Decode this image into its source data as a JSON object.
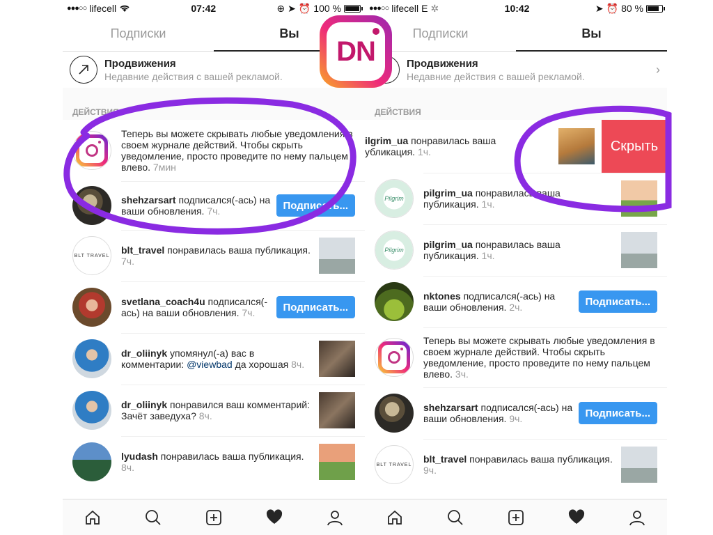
{
  "phones": [
    {
      "status": {
        "carrier": "lifecell",
        "time": "07:42",
        "battery": "100 %",
        "battery_level": 1.0
      },
      "tabs": [
        "Подписки",
        "Вы"
      ],
      "promo": {
        "title": "Продвижения",
        "subtitle": "Недавние действия с вашей рекламой."
      },
      "section": "ДЕЙСТВИЯ",
      "rows": [
        {
          "type": "notice",
          "text": "Теперь вы можете скрывать любые уведомления в своем журнале действий. Чтобы скрыть уведомление, просто проведите по нему пальцем влево.",
          "time": "7мин"
        },
        {
          "type": "follow",
          "user": "shehzarsart",
          "text": "подписался(-ась) на ваши обновления.",
          "time": "7ч.",
          "button": "Подписать..."
        },
        {
          "type": "like",
          "user": "blt_travel",
          "text": "понравилась ваша публикация.",
          "time": "7ч."
        },
        {
          "type": "follow",
          "user": "svetlana_coach4u",
          "text": "подписался(-ась) на ваши обновления.",
          "time": "7ч.",
          "button": "Подписать..."
        },
        {
          "type": "mention",
          "user": "dr_oliinyk",
          "text_before": "упомянул(-а) вас в комментарии:",
          "mention": "@viewbad",
          "text_after": "да хорошая",
          "time": "8ч."
        },
        {
          "type": "like",
          "user": "dr_oliinyk",
          "text": "понравился ваш комментарий: Зачёт заведуха?",
          "time": "8ч."
        },
        {
          "type": "like",
          "user": "lyudash",
          "text": "понравилась ваша публикация.",
          "time": "8ч."
        }
      ]
    },
    {
      "status": {
        "carrier": "lifecell",
        "network": "E",
        "time": "10:42",
        "battery": "80 %",
        "battery_level": 0.8
      },
      "tabs": [
        "Подписки",
        "Вы"
      ],
      "promo": {
        "title": "Продвижения",
        "subtitle": "Недавние действия с вашей рекламой."
      },
      "section": "ДЕЙСТВИЯ",
      "swiped_row": {
        "user": "ilgrim_ua",
        "text": "понравилась ваша убликация.",
        "time": "1ч.",
        "hide_label": "Скрыть"
      },
      "rows": [
        {
          "type": "like",
          "user": "pilgrim_ua",
          "text": "понравилась ваша публикация.",
          "time": "1ч."
        },
        {
          "type": "like",
          "user": "pilgrim_ua",
          "text": "понравилась ваша публикация.",
          "time": "1ч."
        },
        {
          "type": "follow",
          "user": "nktones",
          "text": "подписался(-ась) на ваши обновления.",
          "time": "2ч.",
          "button": "Подписать..."
        },
        {
          "type": "notice",
          "text": "Теперь вы можете скрывать любые уведомления в своем журнале действий. Чтобы скрыть уведомление, просто проведите по нему пальцем влево.",
          "time": "3ч."
        },
        {
          "type": "follow",
          "user": "shehzarsart",
          "text": "подписался(-ась) на ваши обновления.",
          "time": "9ч.",
          "button": "Подписать..."
        },
        {
          "type": "like",
          "user": "blt_travel",
          "text": "понравилась ваша публикация.",
          "time": "9ч."
        }
      ]
    }
  ],
  "watermark": "DN",
  "colors": {
    "follow_blue": "#3897f0",
    "hide_red": "#ed4956",
    "annotation_purple": "#8a2be2",
    "muted": "#999999"
  },
  "nav_icons": [
    "home-icon",
    "search-icon",
    "add-post-icon",
    "heart-icon",
    "profile-icon"
  ]
}
